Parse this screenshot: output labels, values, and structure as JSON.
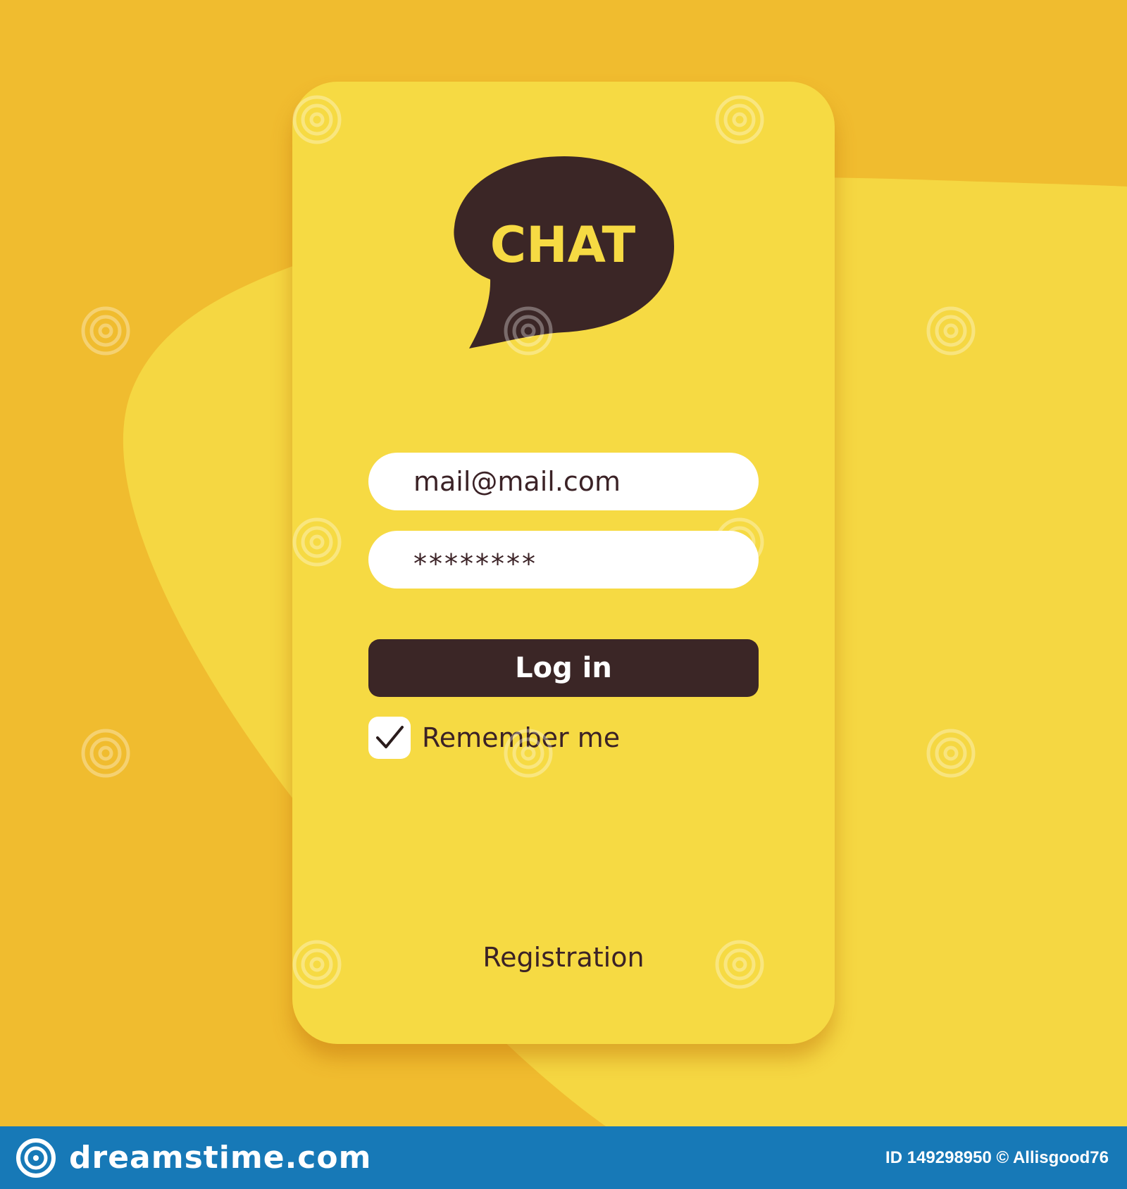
{
  "logo": {
    "text": "CHAT",
    "bubble_color": "#3B2626",
    "text_color": "#F6DA43",
    "icon": "speech-bubble-icon"
  },
  "form": {
    "email_value": "mail@mail.com",
    "password_value": "********",
    "login_label": "Log in",
    "remember_label": "Remember me",
    "remember_checked": true,
    "registration_label": "Registration"
  },
  "colors": {
    "background": "#F0BC2F",
    "background_blob": "#F5D742",
    "phone": "#F6DA43",
    "dark_accent": "#3B2626",
    "footer": "#1779B7"
  },
  "footer": {
    "brand": "dreamstime.com",
    "id_text": "ID 149298950 © Allisgood76"
  }
}
